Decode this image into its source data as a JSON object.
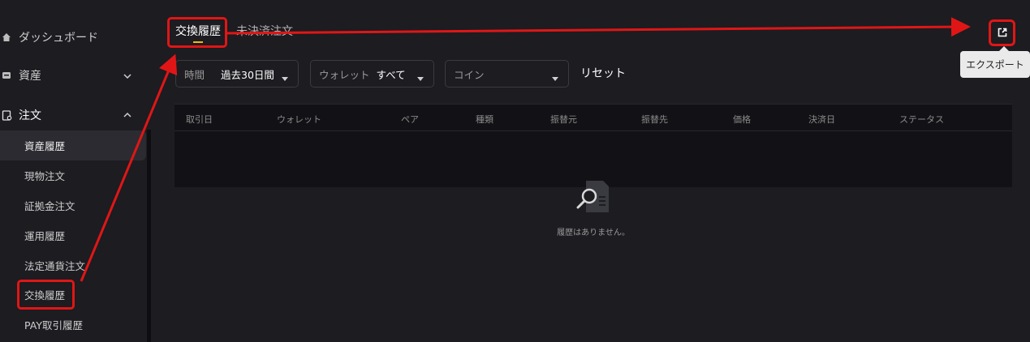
{
  "sidebar": {
    "dashboard": "ダッシュボード",
    "assets": "資産",
    "orders": "注文",
    "sub_items": [
      "資産履歴",
      "現物注文",
      "証拠金注文",
      "運用履歴",
      "法定通貨注文",
      "交換履歴",
      "PAY取引履歴"
    ]
  },
  "tabs": {
    "exchange_history": "交換履歴",
    "open_orders": "未決済注文"
  },
  "filters": {
    "time_key": "時間",
    "time_value": "過去30日間",
    "wallet_key": "ウォレット",
    "wallet_value": "すべて",
    "coin_placeholder": "コイン",
    "reset": "リセット"
  },
  "table": {
    "columns": [
      "取引日",
      "ウォレット",
      "ペア",
      "種類",
      "振替元",
      "振替先",
      "価格",
      "決済日",
      "ステータス"
    ],
    "empty_text": "履歴はありません。"
  },
  "export": {
    "tooltip": "エクスポート"
  },
  "colors": {
    "accent": "#f0b90b",
    "annotation": "#e01616",
    "background": "#1c1c21"
  }
}
